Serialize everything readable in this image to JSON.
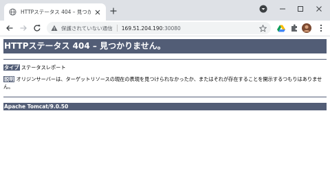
{
  "browser": {
    "tab_title": "HTTPステータス 404 – 見つかりません",
    "url_security_label": "保護されていない通信",
    "url_host": "169.51.204.190",
    "url_port": ":30080",
    "icons": [
      "globe-icon",
      "close-icon",
      "plus-icon",
      "profile-dropdown-icon",
      "minimize-icon",
      "maximize-icon",
      "window-close-icon",
      "back-icon",
      "forward-icon",
      "reload-icon",
      "warning-icon",
      "star-icon",
      "drive-icon",
      "extensions-icon",
      "avatar",
      "menu-icon"
    ]
  },
  "page": {
    "heading": "HTTPステータス 404 – 見つかりません。",
    "type_label": "タイプ",
    "type_value": " ステータスレポート",
    "desc_label": "説明",
    "desc_value": " オリジンサーバーは、ターゲットリソースの現在の表現を見つけられなかったか、またはそれが存在することを開示するつもりはありませ",
    "desc_value_cont": "ん。",
    "footer": "Apache Tomcat/9.0.50"
  },
  "colors": {
    "tomcat_header": "#525d76",
    "tabstrip": "#dee1e6",
    "omnibox": "#f1f3f4"
  }
}
